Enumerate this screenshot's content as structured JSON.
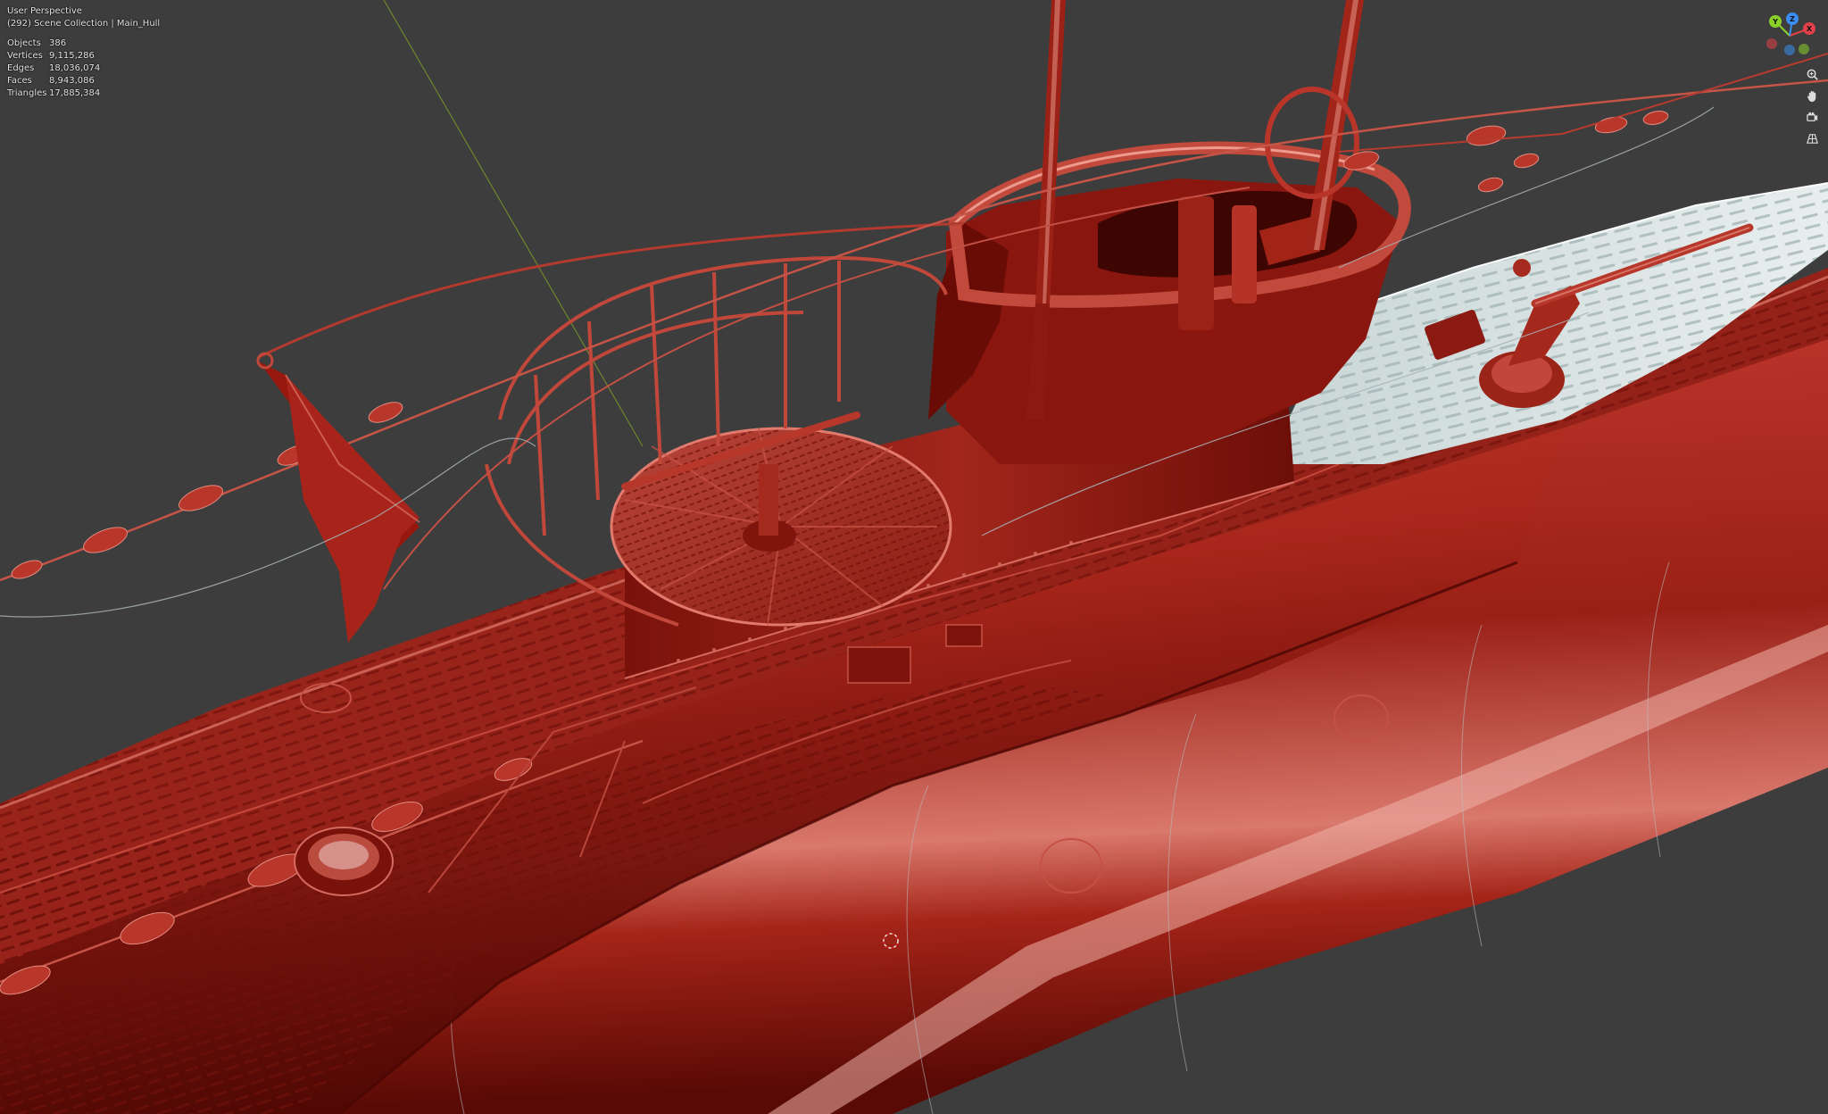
{
  "viewport": {
    "view_name": "User Perspective",
    "collection_line": "(292) Scene Collection | Main_Hull",
    "stats": [
      {
        "label": "Objects",
        "value": "386"
      },
      {
        "label": "Vertices",
        "value": "9,115,286"
      },
      {
        "label": "Edges",
        "value": "18,036,074"
      },
      {
        "label": "Faces",
        "value": "8,943,086"
      },
      {
        "label": "Triangles",
        "value": "17,885,384"
      }
    ],
    "background_color": "#3d3d3d",
    "model_color": "#9b1b12"
  },
  "gizmo": {
    "x_label": "X",
    "y_label": "Y",
    "z_label": "Z",
    "x_color": "#e3414a",
    "y_color": "#8ad22a",
    "z_color": "#3b8ff2"
  },
  "nav_tools": [
    {
      "name": "zoom",
      "icon": "magnifier-icon"
    },
    {
      "name": "pan",
      "icon": "hand-icon"
    },
    {
      "name": "camera",
      "icon": "camera-icon"
    },
    {
      "name": "projection",
      "icon": "grid-icon"
    }
  ]
}
